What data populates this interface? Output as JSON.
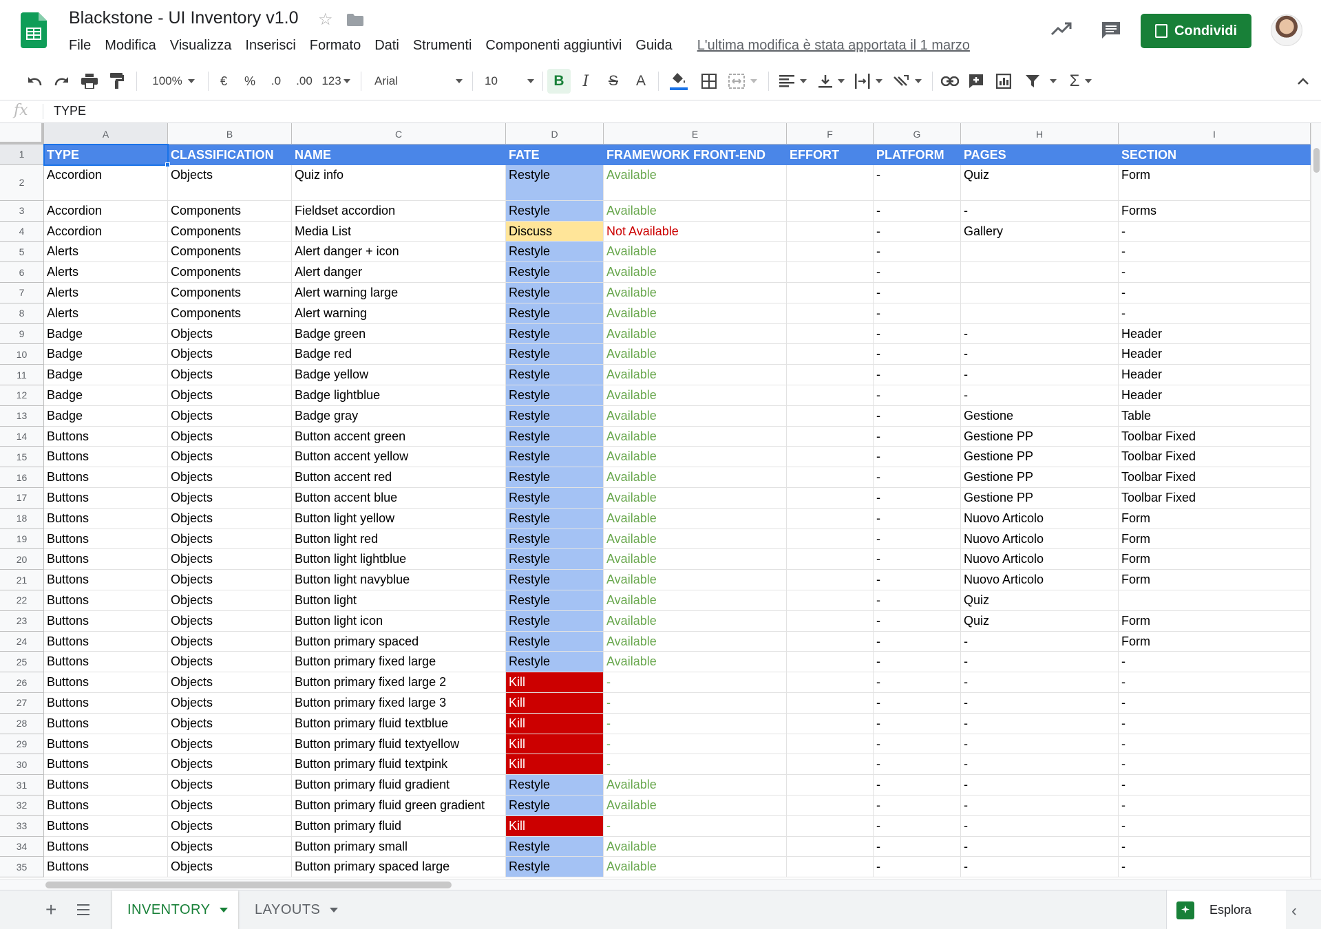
{
  "app": {
    "title": "Blackstone - UI Inventory v1.0",
    "menu": [
      "File",
      "Modifica",
      "Visualizza",
      "Inserisci",
      "Formato",
      "Dati",
      "Strumenti",
      "Componenti aggiuntivi",
      "Guida"
    ],
    "last_edit": "L'ultima modifica è stata apportata il 1 marzo",
    "share_label": "Condividi"
  },
  "toolbar": {
    "zoom": "100%",
    "currency": "€",
    "percent": "%",
    "dec_less": ".0",
    "dec_more": ".00",
    "format_more": "123",
    "font": "Arial",
    "font_size": "10",
    "bold": "B",
    "italic": "I",
    "strike": "S",
    "text_color": "A",
    "functions": "Σ"
  },
  "formula_bar": {
    "fx": "fx",
    "value": "TYPE"
  },
  "columns": [
    "A",
    "B",
    "C",
    "D",
    "E",
    "F",
    "G",
    "H",
    "I"
  ],
  "header_row": {
    "num": "1",
    "cells": [
      "TYPE",
      "CLASSIFICATION",
      "NAME",
      "FATE",
      "FRAMEWORK FRONT-END",
      "EFFORT",
      "PLATFORM",
      "PAGES",
      "SECTION"
    ]
  },
  "rows": [
    {
      "num": "2",
      "cells": [
        "Accordion",
        "Objects",
        "Quiz info",
        "Restyle",
        "Available",
        "",
        "-",
        "Quiz",
        "Form"
      ]
    },
    {
      "num": "3",
      "cells": [
        "Accordion",
        "Components",
        "Fieldset accordion",
        "Restyle",
        "Available",
        "",
        "-",
        "-",
        "Forms"
      ]
    },
    {
      "num": "4",
      "cells": [
        "Accordion",
        "Components",
        "Media List",
        "Discuss",
        "Not Available",
        "",
        "-",
        "Gallery",
        "-"
      ]
    },
    {
      "num": "5",
      "cells": [
        "Alerts",
        "Components",
        "Alert danger + icon",
        "Restyle",
        "Available",
        "",
        "-",
        "",
        "-"
      ]
    },
    {
      "num": "6",
      "cells": [
        "Alerts",
        "Components",
        "Alert danger",
        "Restyle",
        "Available",
        "",
        "-",
        "",
        "-"
      ]
    },
    {
      "num": "7",
      "cells": [
        "Alerts",
        "Components",
        "Alert warning large",
        "Restyle",
        "Available",
        "",
        "-",
        "",
        "-"
      ]
    },
    {
      "num": "8",
      "cells": [
        "Alerts",
        "Components",
        "Alert warning",
        "Restyle",
        "Available",
        "",
        "-",
        "",
        "-"
      ]
    },
    {
      "num": "9",
      "cells": [
        "Badge",
        "Objects",
        "Badge green",
        "Restyle",
        "Available",
        "",
        "-",
        "-",
        "Header"
      ]
    },
    {
      "num": "10",
      "cells": [
        "Badge",
        "Objects",
        "Badge red",
        "Restyle",
        "Available",
        "",
        "-",
        "-",
        "Header"
      ]
    },
    {
      "num": "11",
      "cells": [
        "Badge",
        "Objects",
        "Badge yellow",
        "Restyle",
        "Available",
        "",
        "-",
        "-",
        "Header"
      ]
    },
    {
      "num": "12",
      "cells": [
        "Badge",
        "Objects",
        "Badge lightblue",
        "Restyle",
        "Available",
        "",
        "-",
        "-",
        "Header"
      ]
    },
    {
      "num": "13",
      "cells": [
        "Badge",
        "Objects",
        "Badge gray",
        "Restyle",
        "Available",
        "",
        "-",
        "Gestione",
        "Table"
      ]
    },
    {
      "num": "14",
      "cells": [
        "Buttons",
        "Objects",
        "Button accent green",
        "Restyle",
        "Available",
        "",
        "-",
        "Gestione PP",
        "Toolbar Fixed"
      ]
    },
    {
      "num": "15",
      "cells": [
        "Buttons",
        "Objects",
        "Button accent yellow",
        "Restyle",
        "Available",
        "",
        "-",
        "Gestione PP",
        "Toolbar Fixed"
      ]
    },
    {
      "num": "16",
      "cells": [
        "Buttons",
        "Objects",
        "Button accent red",
        "Restyle",
        "Available",
        "",
        "-",
        "Gestione PP",
        "Toolbar Fixed"
      ]
    },
    {
      "num": "17",
      "cells": [
        "Buttons",
        "Objects",
        "Button accent blue",
        "Restyle",
        "Available",
        "",
        "-",
        "Gestione PP",
        "Toolbar Fixed"
      ]
    },
    {
      "num": "18",
      "cells": [
        "Buttons",
        "Objects",
        "Button light yellow",
        "Restyle",
        "Available",
        "",
        "-",
        "Nuovo Articolo",
        "Form"
      ]
    },
    {
      "num": "19",
      "cells": [
        "Buttons",
        "Objects",
        "Button light red",
        "Restyle",
        "Available",
        "",
        "-",
        "Nuovo Articolo",
        "Form"
      ]
    },
    {
      "num": "20",
      "cells": [
        "Buttons",
        "Objects",
        "Button light lightblue",
        "Restyle",
        "Available",
        "",
        "-",
        "Nuovo Articolo",
        "Form"
      ]
    },
    {
      "num": "21",
      "cells": [
        "Buttons",
        "Objects",
        "Button light navyblue",
        "Restyle",
        "Available",
        "",
        "-",
        "Nuovo Articolo",
        "Form"
      ]
    },
    {
      "num": "22",
      "cells": [
        "Buttons",
        "Objects",
        "Button light",
        "Restyle",
        "Available",
        "",
        "-",
        "Quiz",
        ""
      ]
    },
    {
      "num": "23",
      "cells": [
        "Buttons",
        "Objects",
        "Button light icon",
        "Restyle",
        "Available",
        "",
        "-",
        "Quiz",
        "Form"
      ]
    },
    {
      "num": "24",
      "cells": [
        "Buttons",
        "Objects",
        "Button primary spaced",
        "Restyle",
        "Available",
        "",
        "-",
        "-",
        "Form"
      ]
    },
    {
      "num": "25",
      "cells": [
        "Buttons",
        "Objects",
        "Button primary fixed large",
        "Restyle",
        "Available",
        "",
        "-",
        "-",
        "-"
      ]
    },
    {
      "num": "26",
      "cells": [
        "Buttons",
        "Objects",
        "Button primary fixed large 2",
        "Kill",
        "-",
        "",
        "-",
        "-",
        "-"
      ]
    },
    {
      "num": "27",
      "cells": [
        "Buttons",
        "Objects",
        "Button primary fixed large 3",
        "Kill",
        "-",
        "",
        "-",
        "-",
        "-"
      ]
    },
    {
      "num": "28",
      "cells": [
        "Buttons",
        "Objects",
        "Button primary fluid textblue",
        "Kill",
        "-",
        "",
        "-",
        "-",
        "-"
      ]
    },
    {
      "num": "29",
      "cells": [
        "Buttons",
        "Objects",
        "Button primary fluid textyellow",
        "Kill",
        "-",
        "",
        "-",
        "-",
        "-"
      ]
    },
    {
      "num": "30",
      "cells": [
        "Buttons",
        "Objects",
        "Button primary fluid textpink",
        "Kill",
        "-",
        "",
        "-",
        "-",
        "-"
      ]
    },
    {
      "num": "31",
      "cells": [
        "Buttons",
        "Objects",
        "Button primary fluid gradient",
        "Restyle",
        "Available",
        "",
        "-",
        "-",
        "-"
      ]
    },
    {
      "num": "32",
      "cells": [
        "Buttons",
        "Objects",
        "Button primary fluid green gradient",
        "Restyle",
        "Available",
        "",
        "-",
        "-",
        "-"
      ]
    },
    {
      "num": "33",
      "cells": [
        "Buttons",
        "Objects",
        "Button primary fluid",
        "Kill",
        "-",
        "",
        "-",
        "-",
        "-"
      ]
    },
    {
      "num": "34",
      "cells": [
        "Buttons",
        "Objects",
        "Button primary small",
        "Restyle",
        "Available",
        "",
        "-",
        "-",
        "-"
      ]
    },
    {
      "num": "35",
      "cells": [
        "Buttons",
        "Objects",
        "Button primary spaced large",
        "Restyle",
        "Available",
        "",
        "-",
        "-",
        "-"
      ]
    }
  ],
  "sheets": {
    "active": "INVENTORY",
    "other": "LAYOUTS",
    "add_label": "+",
    "explore_label": "Esplora"
  },
  "colors": {
    "header_bg": "#4a86e8",
    "restyle_bg": "#a4c2f4",
    "discuss_bg": "#ffe599",
    "kill_bg": "#cc0000",
    "available_text": "#6aa84f",
    "not_available_text": "#cc0000",
    "brand_green": "#188038"
  }
}
